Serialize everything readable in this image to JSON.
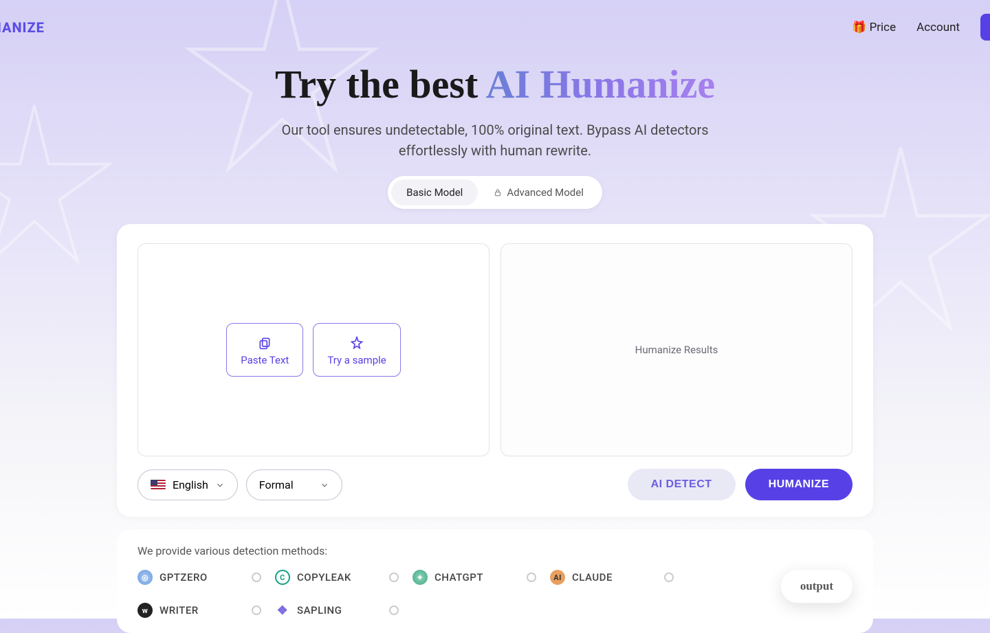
{
  "header": {
    "logo": "UMANIZE",
    "nav": {
      "price_emoji": "🎁",
      "price_label": "Price",
      "account_label": "Account"
    }
  },
  "hero": {
    "title_plain": "Try the best ",
    "title_gradient": "AI Humanize",
    "subtitle": "Our tool ensures undetectable, 100% original text. Bypass AI detectors effortlessly with human rewrite."
  },
  "model_toggle": {
    "basic": "Basic Model",
    "advanced": "Advanced Model"
  },
  "panels": {
    "paste_button": "Paste Text",
    "sample_button": "Try a sample",
    "results_placeholder": "Humanize Results"
  },
  "selects": {
    "language": "English",
    "tone": "Formal"
  },
  "actions": {
    "detect": "AI DETECT",
    "humanize": "HUMANIZE"
  },
  "detectors": {
    "title": "We provide various detection methods:",
    "items": [
      {
        "name": "GPTZERO"
      },
      {
        "name": "COPYLEAK"
      },
      {
        "name": "CHATGPT"
      },
      {
        "name": "CLAUDE"
      },
      {
        "name": "WRITER"
      },
      {
        "name": "SAPLING"
      }
    ],
    "output_label": "output"
  }
}
